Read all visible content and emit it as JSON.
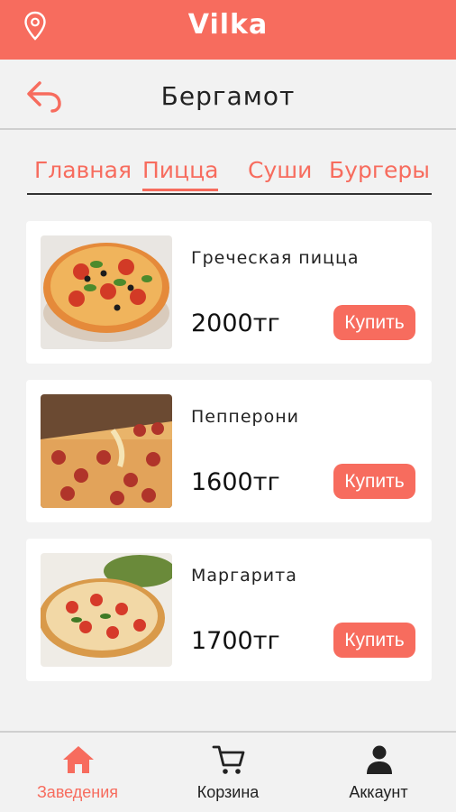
{
  "app": {
    "logo": "Vilka"
  },
  "header": {
    "title": "Бергамот"
  },
  "tabs": [
    {
      "label": "Главная"
    },
    {
      "label": "Пицца",
      "active": true
    },
    {
      "label": "Суши"
    },
    {
      "label": "Бургеры"
    }
  ],
  "products": [
    {
      "name": "Греческая пицца",
      "price": "2000тг",
      "buy": "Купить"
    },
    {
      "name": "Пепперони",
      "price": "1600тг",
      "buy": "Купить"
    },
    {
      "name": "Маргарита",
      "price": "1700тг",
      "buy": "Купить"
    }
  ],
  "nav": [
    {
      "label": "Заведения",
      "icon": "home-icon",
      "active": true
    },
    {
      "label": "Корзина",
      "icon": "cart-icon"
    },
    {
      "label": "Аккаунт",
      "icon": "account-icon"
    }
  ],
  "colors": {
    "accent": "#f76c5e",
    "background": "#f2f2f2",
    "card": "#ffffff"
  }
}
